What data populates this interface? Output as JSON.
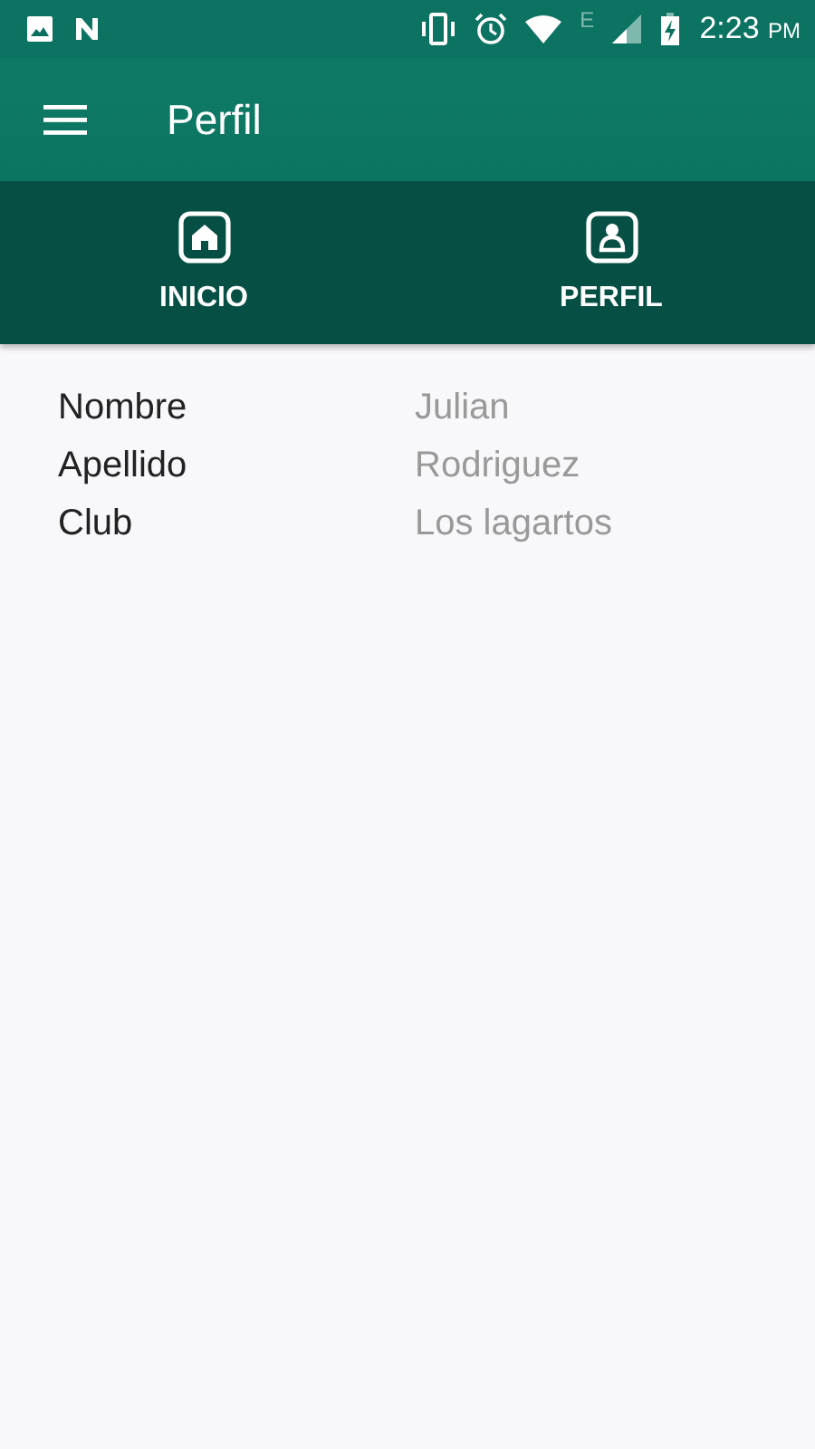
{
  "status_bar": {
    "network_type": "E",
    "time": "2:23",
    "period": "PM"
  },
  "app_bar": {
    "title": "Perfil"
  },
  "tabs": [
    {
      "label": "INICIO",
      "kind": "home"
    },
    {
      "label": "PERFIL",
      "kind": "profile"
    }
  ],
  "fields": [
    {
      "label": "Nombre",
      "value": "Julian"
    },
    {
      "label": "Apellido",
      "value": "Rodriguez"
    },
    {
      "label": "Club",
      "value": "Los lagartos"
    }
  ]
}
